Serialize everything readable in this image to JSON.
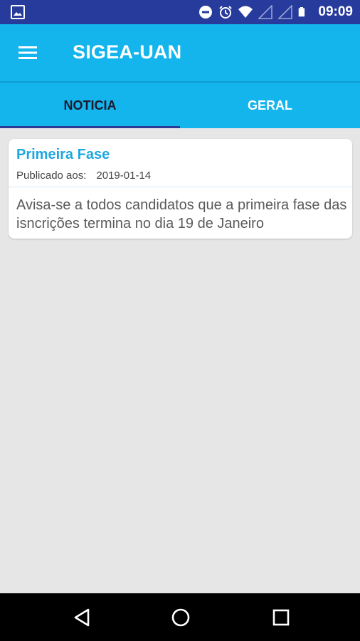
{
  "status_bar": {
    "time": "09:09",
    "icons": [
      "image-icon",
      "do-not-disturb-icon",
      "alarm-icon",
      "wifi-icon",
      "signal-icon",
      "signal-icon",
      "battery-icon"
    ]
  },
  "app_bar": {
    "title": "SIGEA-UAN",
    "menu_icon": "hamburger-menu-icon"
  },
  "tabs": [
    {
      "label": "NOTICIA",
      "selected": true
    },
    {
      "label": "GERAL",
      "selected": false
    }
  ],
  "news": [
    {
      "title": "Primeira Fase",
      "published_label": "Publicado aos:",
      "date": "2019-01-14",
      "body": "Avisa-se a todos candidatos que a primeira fase das isncrições termina no dia 19 de Janeiro"
    }
  ],
  "colors": {
    "status_bar": "#273b9c",
    "app_bar": "#14b4ec",
    "tab_indicator": "#2c3a93",
    "card_title": "#1ea6e0",
    "background": "#e6e6e6"
  },
  "nav_bar": {
    "icons": [
      "back-icon",
      "home-icon",
      "recent-apps-icon"
    ]
  }
}
